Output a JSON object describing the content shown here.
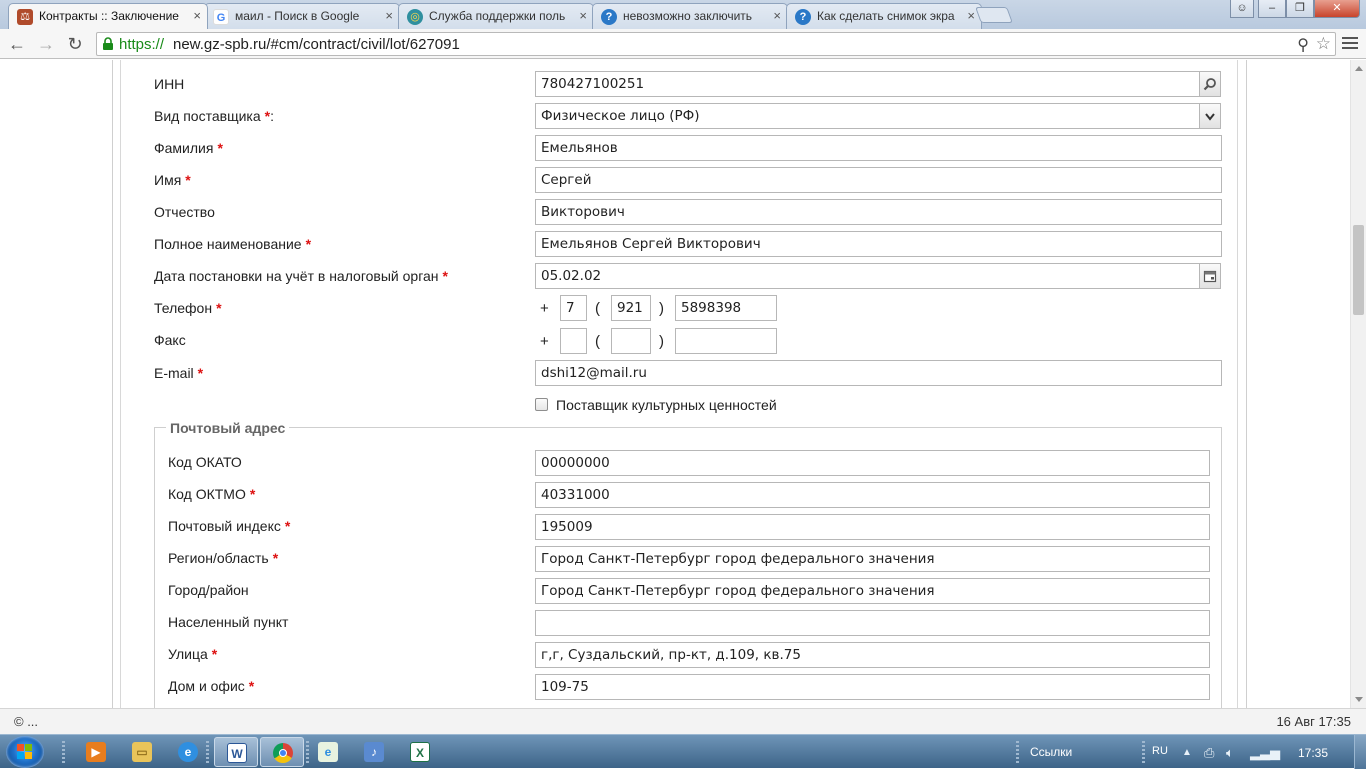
{
  "browser": {
    "tabs": [
      {
        "title": "Контракты :: Заключение",
        "icon": "contracts-favicon",
        "active": true
      },
      {
        "title": "маил - Поиск в Google",
        "icon": "google-favicon",
        "active": false
      },
      {
        "title": "Служба поддержки поль",
        "icon": "support-favicon",
        "active": false
      },
      {
        "title": "невозможно заключить",
        "icon": "question-favicon",
        "active": false
      },
      {
        "title": "Как сделать снимок экра",
        "icon": "question-favicon",
        "active": false
      }
    ],
    "tab_close": "×",
    "url_scheme": "https://",
    "url_rest": "new.gz-spb.ru/#cm/contract/civil/lot/627091",
    "nav": {
      "back": "←",
      "forward": "→",
      "reload": "↻"
    },
    "window_buttons": {
      "minimize": "–",
      "restore": "❐",
      "close": "✕"
    },
    "colors": {
      "secure_url": "#1a8b1a",
      "required_mark": "#d11111"
    }
  },
  "form": {
    "required_mark": "*",
    "inn": {
      "label": "ИНН",
      "value": "780427100251"
    },
    "supplier_type": {
      "label": "Вид поставщика",
      "suffix": ":",
      "value": "Физическое лицо (РФ)"
    },
    "last_name": {
      "label": "Фамилия",
      "value": "Емельянов"
    },
    "first_name": {
      "label": "Имя",
      "value": "Сергей"
    },
    "patronymic": {
      "label": "Отчество",
      "value": "Викторович"
    },
    "full_name": {
      "label": "Полное наименование",
      "value": "Емельянов Сергей Викторович"
    },
    "tax_reg_date": {
      "label": "Дата постановки на учёт в налоговый орган",
      "value": "05.02.02"
    },
    "phone": {
      "label": "Телефон",
      "plus": "+",
      "open_paren": "(",
      "close_paren": ")",
      "country": "7",
      "area": "921",
      "number": "5898398"
    },
    "fax": {
      "label": "Факс",
      "plus": "+",
      "open_paren": "(",
      "close_paren": ")",
      "country": "",
      "area": "",
      "number": ""
    },
    "email": {
      "label": "E-mail",
      "value": "dshi12@mail.ru"
    },
    "cultural_supplier": {
      "label": "Поставщик культурных ценностей",
      "checked": false
    }
  },
  "postal_address": {
    "legend": "Почтовый адрес",
    "okato": {
      "label": "Код ОКАТО",
      "value": "00000000"
    },
    "oktmo": {
      "label": "Код ОКТМО",
      "value": "40331000"
    },
    "postcode": {
      "label": "Почтовый индекс",
      "value": "195009"
    },
    "region": {
      "label": "Регион/область",
      "value": "Город Санкт-Петербург город федерального значения"
    },
    "city": {
      "label": "Город/район",
      "value": "Город Санкт-Петербург город федерального значения"
    },
    "locality": {
      "label": "Населенный пункт",
      "value": ""
    },
    "street": {
      "label": "Улица",
      "value": "г,г, Суздальский, пр-кт, д.109, кв.75"
    },
    "house": {
      "label": "Дом и офис",
      "value": "109-75"
    }
  },
  "footer": {
    "copyright": "© ...",
    "datetime": "16 Авг 17:35"
  },
  "taskbar": {
    "apps": [
      "media-player-icon",
      "explorer-icon",
      "internet-explorer-icon",
      "word-icon",
      "chrome-icon",
      "ie-doc-icon",
      "speaker-app-icon",
      "excel-icon"
    ],
    "tray_links": "Ссылки",
    "tray_lang": "RU",
    "time": "17:35",
    "tray_up": "▲"
  }
}
